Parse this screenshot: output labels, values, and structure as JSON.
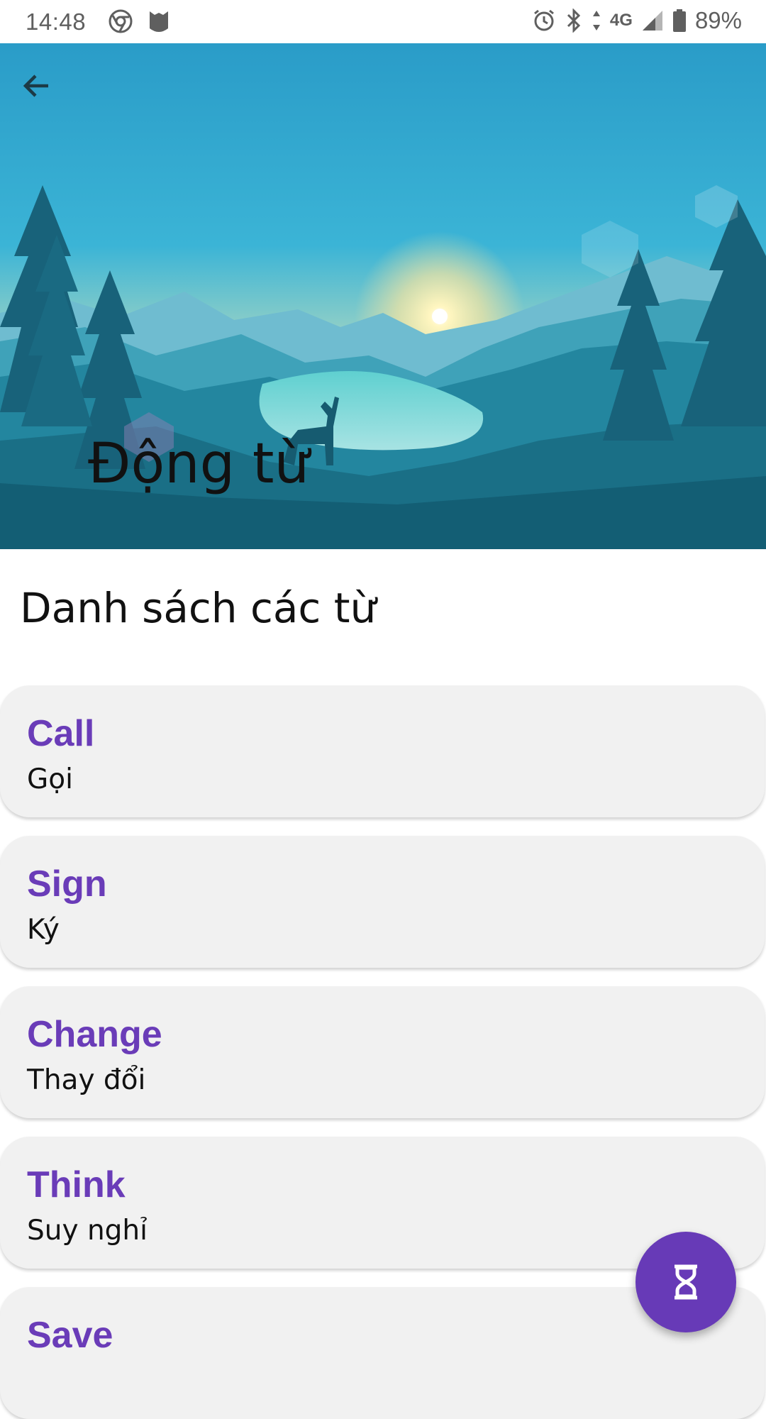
{
  "status_bar": {
    "time": "14:48",
    "network": "4G",
    "battery_percent": "89%",
    "icons": [
      "chrome-icon",
      "mask-app-icon",
      "alarm-icon",
      "bluetooth-icon",
      "data-arrows-icon",
      "signal-icon",
      "battery-icon"
    ]
  },
  "header": {
    "title": "Động từ",
    "back_icon": "arrow-left-icon"
  },
  "section": {
    "title": "Danh sách các từ"
  },
  "words": [
    {
      "en": "Call",
      "vi": "Gọi"
    },
    {
      "en": "Sign",
      "vi": "Ký"
    },
    {
      "en": "Change",
      "vi": "Thay đổi"
    },
    {
      "en": "Think",
      "vi": "Suy nghỉ"
    },
    {
      "en": "Save",
      "vi": ""
    }
  ],
  "fab": {
    "icon": "hourglass-icon"
  },
  "colors": {
    "accent": "#673ab7",
    "word_text": "#6a3cb8",
    "card_bg": "#f1f1f1"
  }
}
